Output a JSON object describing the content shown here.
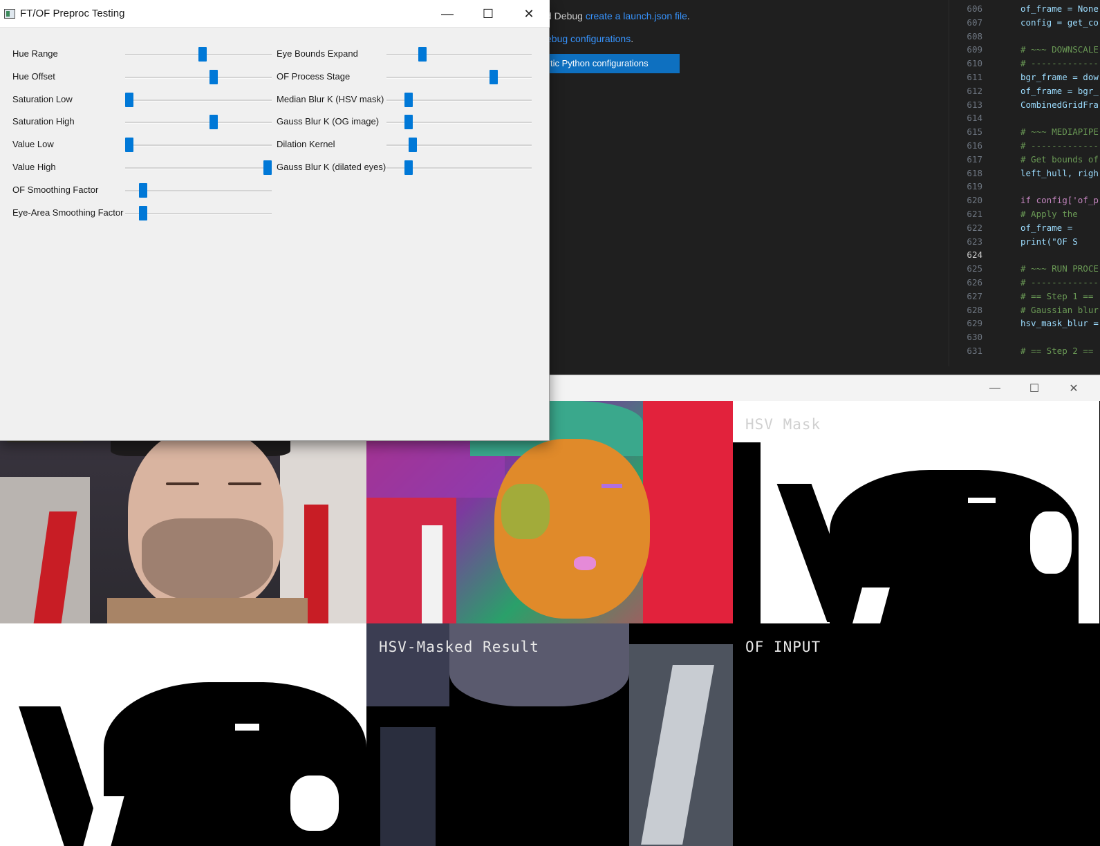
{
  "vscode": {
    "run_debug_prefix": "d Debug ",
    "run_debug_link": "create a launch.json file",
    "run_debug_suffix": ".",
    "debug_config_link": "ebug configurations",
    "debug_config_suffix": ".",
    "python_config_button": "tic Python configurations",
    "code_lines": [
      {
        "num": "606",
        "text": "of_frame = None",
        "kind": "code"
      },
      {
        "num": "607",
        "text": "config = get_co",
        "kind": "code"
      },
      {
        "num": "608",
        "text": "",
        "kind": "code"
      },
      {
        "num": "609",
        "text": "# ~~~ DOWNSCALE",
        "kind": "comment"
      },
      {
        "num": "610",
        "text": "# -------------",
        "kind": "comment"
      },
      {
        "num": "611",
        "text": "bgr_frame = dow",
        "kind": "code"
      },
      {
        "num": "612",
        "text": "of_frame = bgr_",
        "kind": "code"
      },
      {
        "num": "613",
        "text": "CombinedGridFra",
        "kind": "code"
      },
      {
        "num": "614",
        "text": "",
        "kind": "code"
      },
      {
        "num": "615",
        "text": "# ~~~ MEDIAPIPE",
        "kind": "comment"
      },
      {
        "num": "616",
        "text": "# -------------",
        "kind": "comment"
      },
      {
        "num": "617",
        "text": "# Get bounds of",
        "kind": "comment"
      },
      {
        "num": "618",
        "text": "left_hull, righ",
        "kind": "code"
      },
      {
        "num": "619",
        "text": "",
        "kind": "code"
      },
      {
        "num": "620",
        "text": "if config['of_p",
        "kind": "keyword"
      },
      {
        "num": "621",
        "text": "    # Apply the",
        "kind": "comment"
      },
      {
        "num": "622",
        "text": "    of_frame =",
        "kind": "code"
      },
      {
        "num": "623",
        "text": "    print(\"OF S",
        "kind": "code"
      },
      {
        "num": "624",
        "text": "",
        "kind": "current"
      },
      {
        "num": "625",
        "text": "# ~~~ RUN PROCE",
        "kind": "comment"
      },
      {
        "num": "626",
        "text": "# -------------",
        "kind": "comment"
      },
      {
        "num": "627",
        "text": "# == Step 1 ==",
        "kind": "comment"
      },
      {
        "num": "628",
        "text": "# Gaussian blur",
        "kind": "comment"
      },
      {
        "num": "629",
        "text": "hsv_mask_blur =",
        "kind": "code"
      },
      {
        "num": "630",
        "text": "",
        "kind": "code"
      },
      {
        "num": "631",
        "text": "# == Step 2 ==",
        "kind": "comment"
      }
    ]
  },
  "trackbar_window": {
    "title": "FT/OF Preproc Testing",
    "controls": {
      "minimize": "—",
      "maximize": "☐",
      "close": "✕"
    },
    "left_sliders": [
      {
        "label": "Hue Range",
        "value_fraction": 0.53
      },
      {
        "label": "Hue Offset",
        "value_fraction": 0.61
      },
      {
        "label": "Saturation Low",
        "value_fraction": 0.0
      },
      {
        "label": "Saturation High",
        "value_fraction": 0.61
      },
      {
        "label": "Value Low",
        "value_fraction": 0.0
      },
      {
        "label": "Value High",
        "value_fraction": 1.0
      },
      {
        "label": "OF Smoothing Factor",
        "value_fraction": 0.1
      },
      {
        "label": "Eye-Area Smoothing Factor",
        "value_fraction": 0.1
      }
    ],
    "right_sliders": [
      {
        "label": "Eye Bounds Expand",
        "value_fraction": 0.23
      },
      {
        "label": "OF Process Stage",
        "value_fraction": 0.75
      },
      {
        "label": "Median Blur K (HSV mask)",
        "value_fraction": 0.13
      },
      {
        "label": "Gauss Blur K (OG image)",
        "value_fraction": 0.13
      },
      {
        "label": "Dilation Kernel",
        "value_fraction": 0.16
      },
      {
        "label": "Gauss Blur K (dilated eyes)",
        "value_fraction": 0.13
      }
    ]
  },
  "display_window": {
    "controls": {
      "minimize": "—",
      "maximize": "☐",
      "close": "✕"
    },
    "cell_labels": {
      "hsv_mask": "HSV Mask",
      "masked_result": "HSV-Masked Result",
      "of_input": "OF INPUT"
    }
  },
  "colors": {
    "accent": "#0078d7",
    "vscode_button": "#0e70c0",
    "link": "#3794ff"
  }
}
